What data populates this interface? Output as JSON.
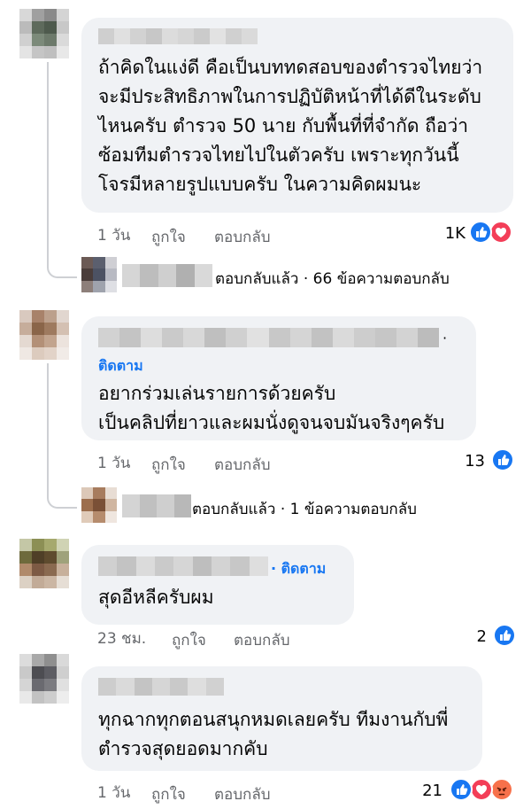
{
  "colors": {
    "link": "#1877f2",
    "bubble": "#f0f2f5",
    "meta": "#65676b",
    "love": "#f33e58",
    "angry": "#f7714b"
  },
  "comments": [
    {
      "lines": [
        "ถ้าคิดในแง่ดี คือเป็นบททดสอบของตำรวจไทยว่า",
        "จะมีประสิทธิภาพในการปฏิบัติหน้าที่ได้ดีในระดับ",
        "ไหนครับ ตำรวจ 50 นาย กับพื้นที่ที่จำกัด ถือว่า",
        "ซ้อมทีมตำรวจไทยไปในตัวครับ เพราะทุกวันนี้",
        "โจรมีหลายรูปแบบครับ ในความคิดผมนะ"
      ],
      "time": "1 วัน",
      "like": "ถูกใจ",
      "reply": "ตอบกลับ",
      "count": "1K",
      "reactions": [
        "like-icon",
        "love-icon"
      ],
      "replies_summary": "ตอบกลับแล้ว · 66 ข้อความตอบกลับ"
    },
    {
      "follow": "ติดตาม",
      "lines": [
        "อยากร่วมเล่นรายการด้วยครับ",
        "เป็นคลิปที่ยาวและผมนั่งดูจนจบมันจริงๆครับ"
      ],
      "time": "1 วัน",
      "like": "ถูกใจ",
      "reply": "ตอบกลับ",
      "count": "13",
      "reactions": [
        "like-icon"
      ],
      "replies_summary": "ตอบกลับแล้ว · 1 ข้อความตอบกลับ"
    },
    {
      "follow": "· ติดตาม",
      "lines": [
        "สุดอีหลีครับผม"
      ],
      "time": "23 ชม.",
      "like": "ถูกใจ",
      "reply": "ตอบกลับ",
      "count": "2",
      "reactions": [
        "like-icon"
      ]
    },
    {
      "lines": [
        "ทุกฉากทุกตอนสนุกหมดเลยครับ ทีมงานกับพี่",
        "ตำรวจสุดยอดมากคับ"
      ],
      "time": "1 วัน",
      "like": "ถูกใจ",
      "reply": "ตอบกลับ",
      "count": "21",
      "reactions": [
        "like-icon",
        "love-icon",
        "angry-icon"
      ]
    }
  ]
}
